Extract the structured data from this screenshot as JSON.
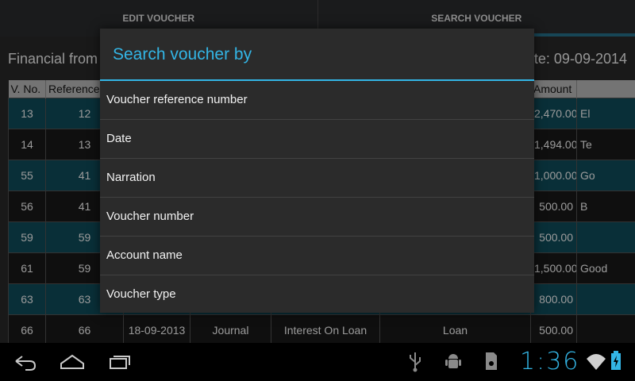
{
  "tabs": {
    "edit": "EDIT VOUCHER",
    "search": "SEARCH VOUCHER"
  },
  "financial": {
    "left": "Financial from",
    "right": "te: 09-09-2014"
  },
  "table": {
    "headers": [
      "V. No.",
      "Reference",
      "",
      "",
      "",
      "",
      "Amount",
      ""
    ],
    "rows": [
      [
        "13",
        "12",
        "",
        "",
        "",
        "",
        "2,470.00",
        "El"
      ],
      [
        "14",
        "13",
        "",
        "",
        "",
        "",
        "1,494.00",
        "Te"
      ],
      [
        "55",
        "41",
        "",
        "",
        "",
        "",
        "1,000.00",
        "Go"
      ],
      [
        "56",
        "41",
        "",
        "",
        "",
        "",
        "500.00",
        "B"
      ],
      [
        "59",
        "59",
        "",
        "",
        "",
        "",
        "500.00",
        ""
      ],
      [
        "61",
        "59",
        "",
        "",
        "",
        "",
        "1,500.00",
        "Good"
      ],
      [
        "63",
        "63",
        "",
        "",
        "",
        "",
        "800.00",
        ""
      ],
      [
        "66",
        "66",
        "18-09-2013",
        "Journal",
        "Interest On Loan",
        "Loan",
        "500.00",
        ""
      ]
    ]
  },
  "dialog": {
    "title": "Search voucher by",
    "options": [
      "Voucher reference number",
      "Date",
      "Narration",
      "Voucher number",
      "Account name",
      "Voucher type"
    ]
  },
  "status": {
    "time": "1:36"
  },
  "icons": [
    "back-icon",
    "home-icon",
    "recent-apps-icon",
    "usb-icon",
    "android-debug-icon",
    "sd-card-icon",
    "wifi-icon",
    "battery-charging-icon"
  ],
  "colors": {
    "accent": "#33b5e5",
    "teal_row": "#0d3f4b",
    "dialog_bg": "#2b2b2b"
  }
}
